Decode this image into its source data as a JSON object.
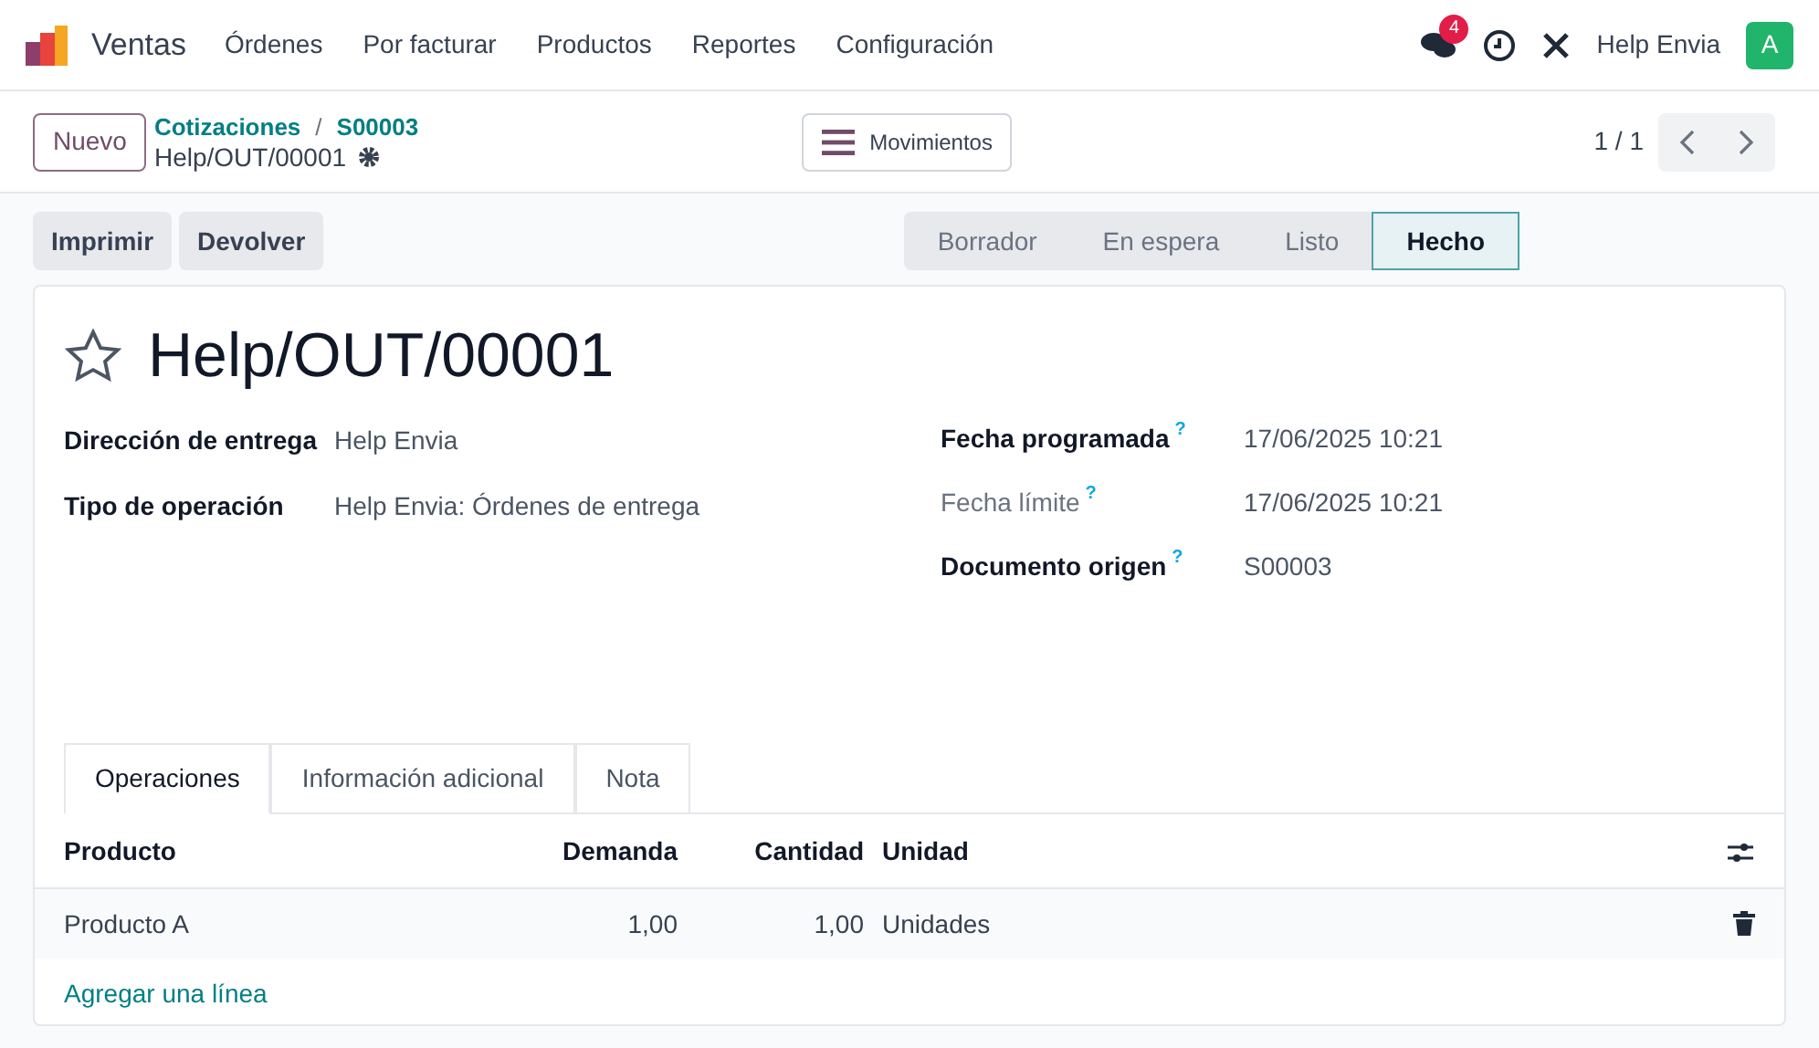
{
  "navbar": {
    "app": "Ventas",
    "menu": [
      "Órdenes",
      "Por facturar",
      "Productos",
      "Reportes",
      "Configuración"
    ],
    "messages_count": "4",
    "user": "Help Envia",
    "avatar": "A"
  },
  "control_panel": {
    "new_button": "Nuevo",
    "breadcrumbs": [
      "Cotizaciones",
      "S00003"
    ],
    "separator": "/",
    "current": "Help/OUT/00001",
    "moves_button": "Movimientos",
    "pager": "1 / 1"
  },
  "actions": [
    "Imprimir",
    "Devolver"
  ],
  "stages": [
    {
      "label": "Borrador",
      "selected": false
    },
    {
      "label": "En espera",
      "selected": false
    },
    {
      "label": "Listo",
      "selected": false
    },
    {
      "label": "Hecho",
      "selected": true
    }
  ],
  "form": {
    "title": "Help/OUT/00001",
    "favorite": false,
    "left_fields": [
      {
        "label": "Dirección de entrega",
        "value": "Help Envia"
      },
      {
        "label": "Tipo de operación",
        "value": "Help Envia: Órdenes de entrega"
      }
    ],
    "right_fields": [
      {
        "label": "Fecha programada",
        "help": "?",
        "value": "17/06/2025 10:21",
        "muted": false
      },
      {
        "label": "Fecha límite",
        "help": "?",
        "value": "17/06/2025 10:21",
        "muted": true
      },
      {
        "label": "Documento origen",
        "help": "?",
        "value": "S00003",
        "muted": false
      }
    ]
  },
  "tabs": [
    {
      "label": "Operaciones",
      "selected": true
    },
    {
      "label": "Información adicional",
      "selected": false
    },
    {
      "label": "Nota",
      "selected": false
    }
  ],
  "table": {
    "columns": [
      "Producto",
      "Demanda",
      "Cantidad",
      "Unidad"
    ],
    "rows": [
      [
        "Producto A",
        "1,00",
        "1,00",
        "Unidades"
      ]
    ],
    "add_line": "Agregar una línea"
  }
}
